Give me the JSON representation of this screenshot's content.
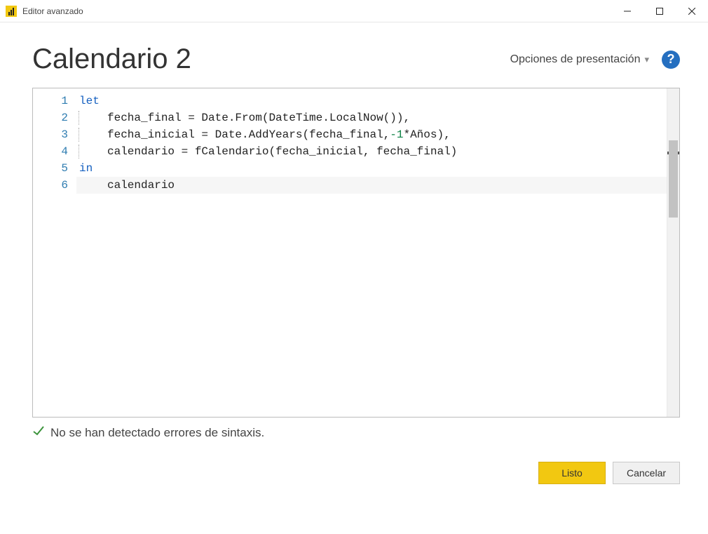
{
  "window": {
    "title": "Editor avanzado"
  },
  "header": {
    "query_name": "Calendario 2",
    "display_options_label": "Opciones de presentación"
  },
  "editor": {
    "line_numbers": [
      "1",
      "2",
      "3",
      "4",
      "5",
      "6"
    ],
    "lines": {
      "l1_kw": "let",
      "l2_text": "fecha_final = Date.From(DateTime.LocalNow()),",
      "l3_pre": "fecha_inicial = Date.AddYears(fecha_final,",
      "l3_num": "-1",
      "l3_post": "*Años),",
      "l4_text": "calendario = fCalendario(fecha_inicial, fecha_final)",
      "l5_kw": "in",
      "l6_text": "calendario"
    }
  },
  "status": {
    "message": "No se han detectado errores de sintaxis."
  },
  "buttons": {
    "done": "Listo",
    "cancel": "Cancelar"
  }
}
